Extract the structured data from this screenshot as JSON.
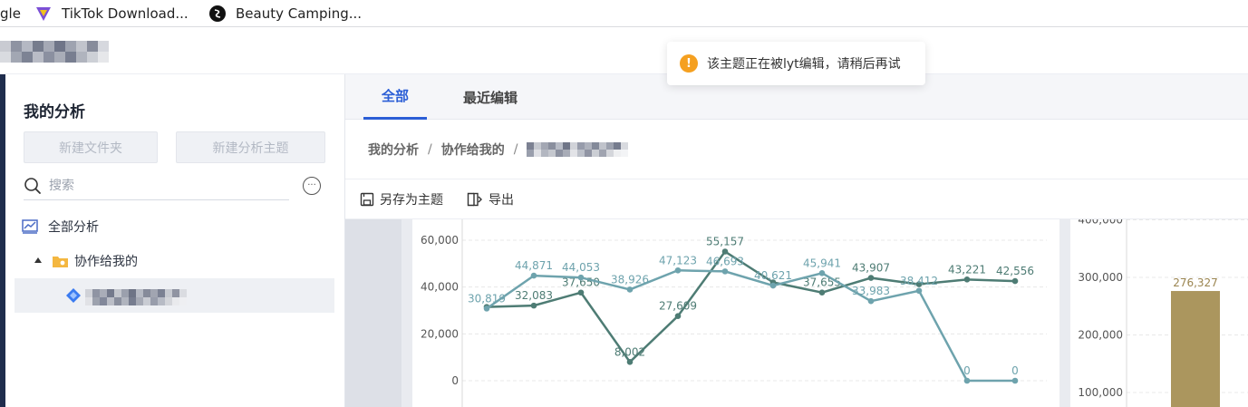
{
  "bookmarks": {
    "google": "gle",
    "tiktok": "TikTok Download...",
    "beauty": "Beauty Camping..."
  },
  "toast": {
    "icon": "warning-icon",
    "message": "该主题正在被lyt编辑，请稍后再试"
  },
  "sidebar": {
    "title": "我的分析",
    "new_folder": "新建文件夹",
    "new_theme": "新建分析主题",
    "search_placeholder": "搜索",
    "tree": {
      "all": "全部分析",
      "collab": "协作给我的"
    }
  },
  "tabs": [
    "全部",
    "最近编辑"
  ],
  "breadcrumb": [
    "我的分析",
    "协作给我的"
  ],
  "toolbar": {
    "save_as": "另存为主题",
    "export": "导出"
  },
  "chart_data": [
    {
      "type": "line",
      "y_ticks": [
        "60,000",
        "40,000",
        "20,000",
        "0"
      ],
      "ylim": [
        0,
        60000
      ],
      "series": [
        {
          "color": "#4e7c74",
          "values": [
            31500,
            32083,
            37650,
            8002,
            27609,
            55157,
            42000,
            37655,
            43907,
            41200,
            43221,
            42556
          ],
          "labels": [
            "",
            "32,083",
            "37,650",
            "8,002",
            "27,609",
            "55,157",
            "",
            "37,655",
            "43,907",
            "",
            "43,221",
            "42,556"
          ]
        },
        {
          "color": "#6ea3ad",
          "values": [
            30819,
            44871,
            44053,
            38926,
            47123,
            46693,
            40621,
            45941,
            33983,
            38412,
            0,
            0
          ],
          "labels": [
            "30,819",
            "44,871",
            "44,053",
            "38,926",
            "47,123",
            "46,693",
            "40,621",
            "45,941",
            "33,983",
            "38,412",
            "0",
            "0"
          ]
        }
      ]
    },
    {
      "type": "bar",
      "y_ticks": [
        "400,000",
        "300,000",
        "200,000",
        "100,000"
      ],
      "ylim": [
        100000,
        400000
      ],
      "color": "#ab965e",
      "values": [
        276327
      ],
      "labels": [
        "276,327"
      ]
    }
  ]
}
